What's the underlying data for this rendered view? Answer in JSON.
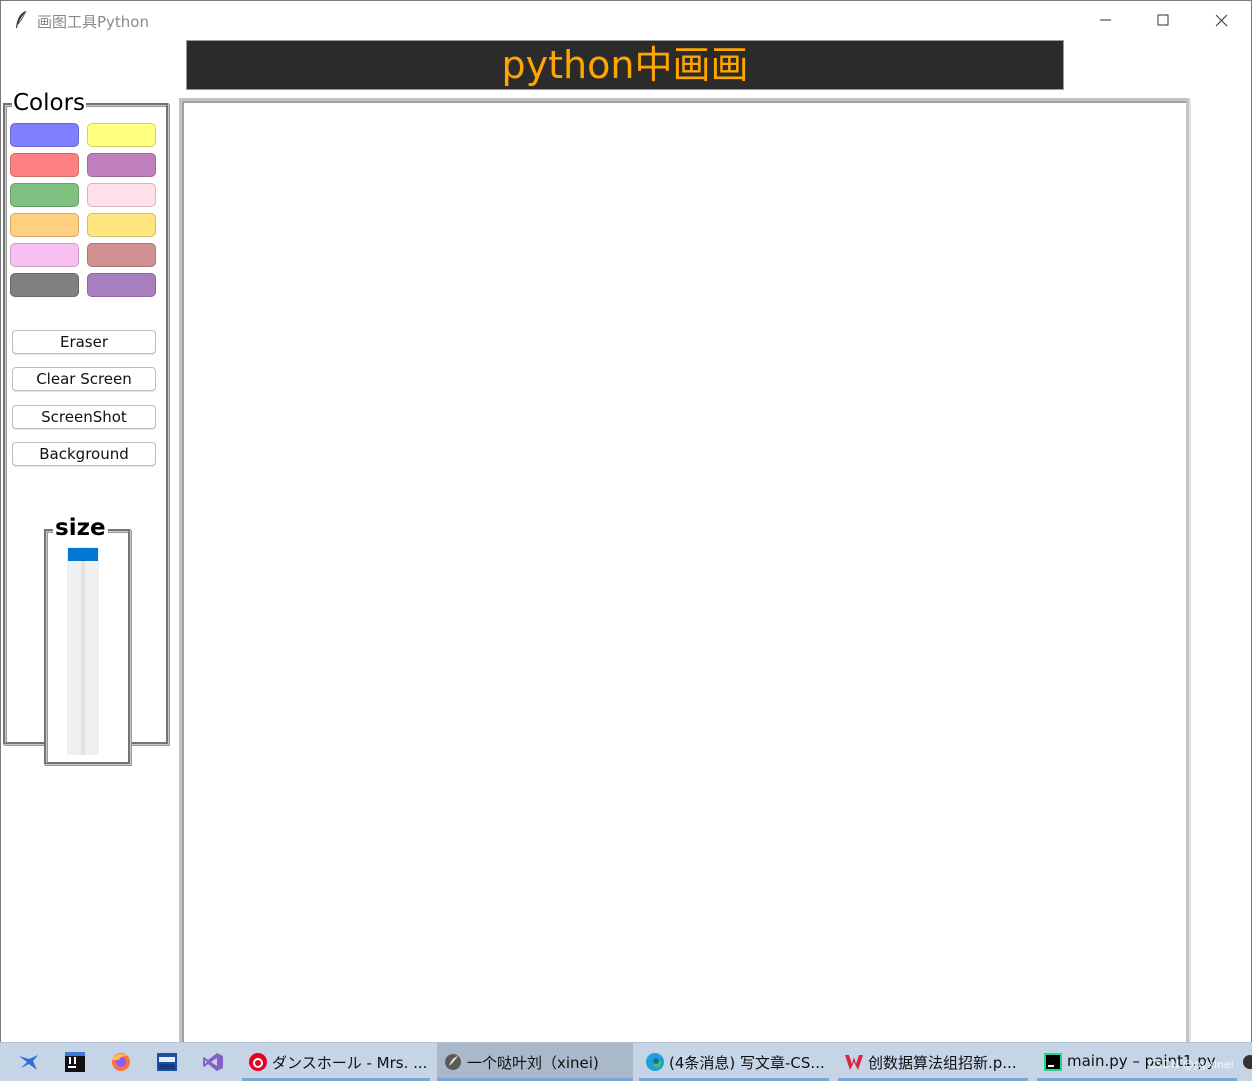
{
  "window": {
    "title": "画图工具Python"
  },
  "banner": {
    "text": "python中画画",
    "bg_color": "#2b2b2b",
    "text_color": "#ffa500"
  },
  "colors_panel": {
    "label": "Colors",
    "swatches": [
      {
        "color": "#8080ff"
      },
      {
        "color": "#ffff80"
      },
      {
        "color": "#ff8080"
      },
      {
        "color": "#c080c0"
      },
      {
        "color": "#80c080"
      },
      {
        "color": "#ffe0e8"
      },
      {
        "color": "#ffd080"
      },
      {
        "color": "#ffe680"
      },
      {
        "color": "#f8c0f0"
      },
      {
        "color": "#d09090"
      },
      {
        "color": "#808080"
      },
      {
        "color": "#a880c0"
      }
    ],
    "buttons": {
      "eraser": "Eraser",
      "clear": "Clear Screen",
      "screenshot": "ScreenShot",
      "background": "Background"
    }
  },
  "size_panel": {
    "label": "size",
    "value_fraction": 0,
    "thumb_color": "#0078d7"
  },
  "taskbar": {
    "icons": [
      "hummingbird-icon",
      "intellij-icon",
      "firefox-icon",
      "devcpp-icon",
      "visual-studio-icon"
    ],
    "items": [
      {
        "label": "ダンスホール - Mrs. ...",
        "icon": "netease-music-icon"
      },
      {
        "label": "一个哒叶刘（xinei)",
        "icon": "feather-icon"
      },
      {
        "label": "(4条消息) 写文章-CS...",
        "icon": "edge-icon"
      },
      {
        "label": "创数据算法组招新.p...",
        "icon": "wps-icon"
      },
      {
        "label": "main.py – paint1.py",
        "icon": "pycharm-icon"
      }
    ],
    "watermark": "CSDN @pyxinei"
  }
}
